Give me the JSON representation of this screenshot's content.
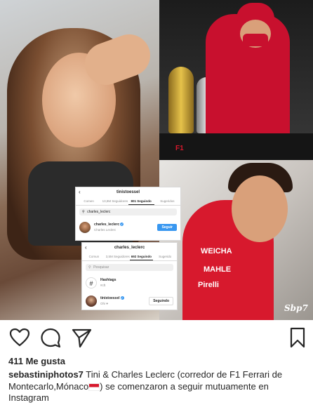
{
  "photo": {
    "watermark": "Sbp7",
    "sponsors": [
      "WEICHA",
      "MAHLE",
      "Pirelli"
    ],
    "podium_sign": "F1"
  },
  "card_top": {
    "back_icon": "chevron-left-icon",
    "username": "tinistoessel",
    "tabs": [
      {
        "label": "Comen",
        "active": false
      },
      {
        "label": "13,8M Seguidores",
        "active": false
      },
      {
        "label": "801 Seguindo",
        "active": true
      },
      {
        "label": "Sugeridos",
        "active": false
      }
    ],
    "search_value": "charles_leclerc",
    "row": {
      "username": "charles_leclerc",
      "fullname": "Charles Leclerc",
      "button": "Seguir"
    }
  },
  "card_bottom": {
    "back_icon": "chevron-left-icon",
    "username": "charles_leclerc",
    "tabs": [
      {
        "label": "Comun",
        "active": false
      },
      {
        "label": "3,5M Seguidores",
        "active": false
      },
      {
        "label": "692 Seguindo",
        "active": true
      },
      {
        "label": "Sugerido",
        "active": false
      }
    ],
    "search_placeholder": "Pesquisar",
    "rows": [
      {
        "username": "Hashtags",
        "fullname": "#cft",
        "button": ""
      },
      {
        "username": "tinistoessel",
        "fullname": "Ohi ♥",
        "button": "Seguindo"
      }
    ]
  },
  "actions": {
    "like_icon": "heart-icon",
    "comment_icon": "comment-icon",
    "share_icon": "send-icon",
    "save_icon": "bookmark-icon"
  },
  "likes": "411 Me gusta",
  "caption": {
    "author": "sebastiniphotos7",
    "text": " Tini & Charles Leclerc (corredor de F1 Ferrari de Montecarlo,Mónaco",
    "text_after": ") se comenzaron a seguir mutuamente en Instagram"
  },
  "colors": {
    "instagram_blue": "#3897f0",
    "ferrari_red": "#d7192d",
    "text": "#262626",
    "muted": "#8e8e8e"
  }
}
